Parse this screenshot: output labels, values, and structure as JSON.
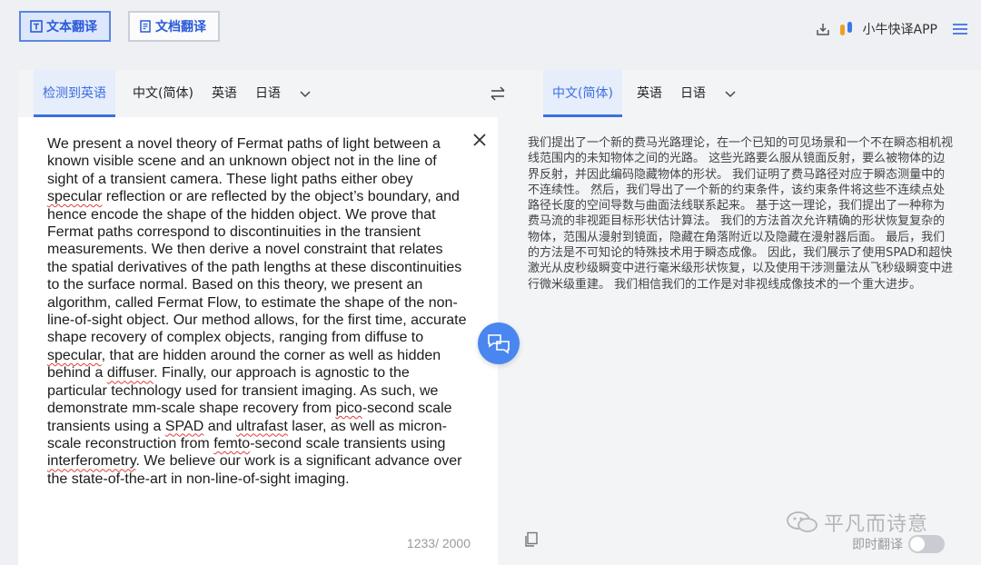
{
  "topbar": {
    "text_translate": "文本翻译",
    "doc_translate": "文档翻译",
    "app_name": "小牛快译APP"
  },
  "source": {
    "detected_lang": "检测到英语",
    "langs": [
      "中文(简体)",
      "英语",
      "日语"
    ],
    "segments": [
      {
        "t": "We present a novel theory of Fermat paths of light between a known visible scene and an unknown object not in the line of sight of a transient camera. These light paths either obey ",
        "s": false
      },
      {
        "t": "specular",
        "s": true
      },
      {
        "t": " reflection or are reflected by the object’s boundary, and hence encode the shape of the hidden object. We prove that Fermat paths correspond to discontinuities in the transient measurements. We then derive a novel constraint that relates the spatial derivatives of the path lengths at these discontinuities to the surface normal. Based on this theory, we present an algorithm, called Fermat Flow, to estimate the shape of the non-line-of-sight object. Our method allows, for the first time, accurate shape recovery of complex objects, ranging from diffuse to ",
        "s": false
      },
      {
        "t": "specular",
        "s": true
      },
      {
        "t": ", that are hidden around the corner as well as hidden behind a ",
        "s": false
      },
      {
        "t": "diffuser",
        "s": true
      },
      {
        "t": ". Finally, our approach is agnostic to the particular technology used for transient imaging. As such, we demonstrate mm-scale shape recovery from ",
        "s": false
      },
      {
        "t": "pico",
        "s": true
      },
      {
        "t": "-second scale transients using a ",
        "s": false
      },
      {
        "t": "SPAD",
        "s": true
      },
      {
        "t": " and ",
        "s": false
      },
      {
        "t": "ultrafast",
        "s": true
      },
      {
        "t": " laser, as well as micron-scale reconstruction from ",
        "s": false
      },
      {
        "t": "femto",
        "s": true
      },
      {
        "t": "-second scale transients using ",
        "s": false
      },
      {
        "t": "interferometry",
        "s": true
      },
      {
        "t": ". We believe our work is a significant advance over the state-of-the-art in non-line-of-sight imaging.",
        "s": false
      }
    ],
    "counter": "1233/ 2000"
  },
  "target": {
    "langs": [
      "中文(简体)",
      "英语",
      "日语"
    ],
    "text": "我们提出了一个新的费马光路理论，在一个已知的可见场景和一个不在瞬态相机视线范围内的未知物体之间的光路。 这些光路要么服从镜面反射，要么被物体的边界反射，并因此编码隐藏物体的形状。 我们证明了费马路径对应于瞬态测量中的不连续性。 然后，我们导出了一个新的约束条件，该约束条件将这些不连续点处路径长度的空间导数与曲面法线联系起来。 基于这一理论，我们提出了一种称为费马流的非视距目标形状估计算法。 我们的方法首次允许精确的形状恢复复杂的物体，范围从漫射到镜面，隐藏在角落附近以及隐藏在漫射器后面。 最后，我们的方法是不可知论的特殊技术用于瞬态成像。 因此，我们展示了使用SPAD和超快激光从皮秒级瞬变中进行毫米级形状恢复，以及使用干涉测量法从飞秒级瞬变中进行微米级重建。 我们相信我们的工作是对非视线成像技术的一个重大进步。",
    "watermark": "平凡而诗意",
    "instant_label": "即时翻译",
    "instant_on": false
  },
  "colors": {
    "accent": "#3c6fe0",
    "fab": "#4a86f0"
  }
}
